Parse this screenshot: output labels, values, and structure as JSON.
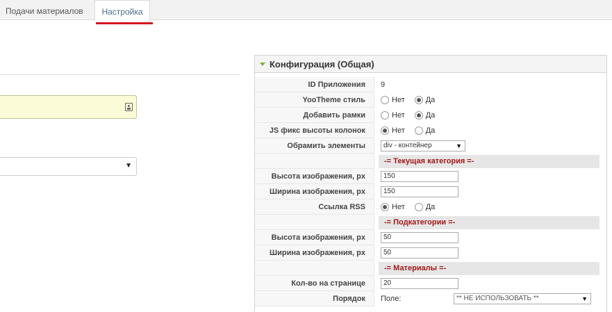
{
  "tabs": [
    {
      "label": "Подачи материалов"
    },
    {
      "label": "Настройка"
    }
  ],
  "panel": {
    "title": "Конфигурация (Общая)",
    "app_id": {
      "label": "ID Приложения",
      "value": "9"
    },
    "yootheme_style": {
      "label": "YooTheme стиль",
      "no": "Нет",
      "yes": "Да",
      "selected": "yes"
    },
    "add_frames": {
      "label": "Добавить рамки",
      "no": "Нет",
      "yes": "Да",
      "selected": "yes"
    },
    "js_fix": {
      "label": "JS фикс высоты колонок",
      "no": "Нет",
      "yes": "Да",
      "selected": "no"
    },
    "wrap_elements": {
      "label": "Обрамить элементы",
      "value": "div - контейнер"
    },
    "section_current": "-= Текущая категория =-",
    "current_img_height": {
      "label": "Высота изображения, px",
      "value": "150"
    },
    "current_img_width": {
      "label": "Ширина изображения, px",
      "value": "150"
    },
    "rss_link": {
      "label": "Ссылка RSS",
      "no": "Нет",
      "yes": "Да",
      "selected": "no"
    },
    "section_sub": "-= Подкатегории =-",
    "sub_img_height": {
      "label": "Высота изображения, px",
      "value": "50"
    },
    "sub_img_width": {
      "label": "Ширина изображения, px",
      "value": "50"
    },
    "section_items": "-= Материалы =-",
    "per_page": {
      "label": "Кол-во на странице",
      "value": "20"
    },
    "order": {
      "label": "Порядок",
      "field_label": "Поле:",
      "value": "** НЕ ИСПОЛЬЗОВАТЬ **"
    }
  },
  "colors": {
    "accent_underline": "#d9121e",
    "section_text": "#a31818",
    "toggle": "#78b243",
    "input_bg": "#fbfbd8"
  },
  "icons": {
    "dropdown": "▼",
    "input_addon": "contact-card-icon"
  }
}
